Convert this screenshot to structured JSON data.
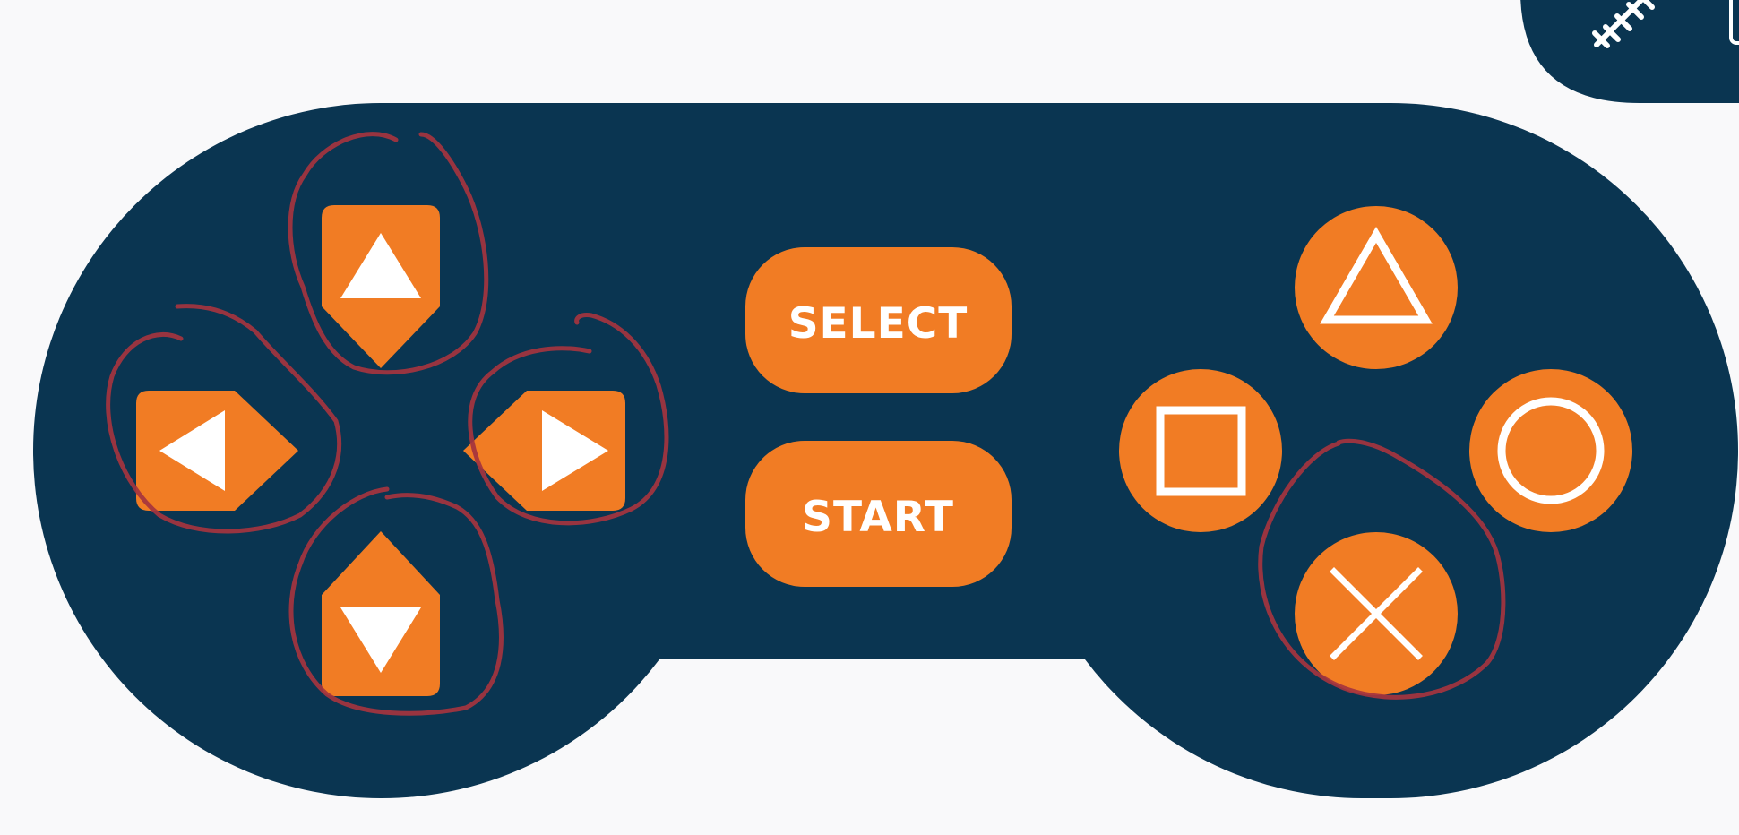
{
  "colors": {
    "background": "#f9f9fa",
    "body": "#0a3551",
    "button": "#f17c24",
    "glyph": "#ffffff",
    "annotation": "#a5343f"
  },
  "dpad": {
    "up_icon": "arrow-up-icon",
    "down_icon": "arrow-down-icon",
    "left_icon": "arrow-left-icon",
    "right_icon": "arrow-right-icon"
  },
  "center": {
    "select_label": "SELECT",
    "start_label": "START"
  },
  "face_buttons": {
    "triangle_icon": "triangle-icon",
    "square_icon": "square-icon",
    "circle_icon": "circle-icon",
    "cross_icon": "cross-icon"
  },
  "corner_panel": {
    "icon": "disconnected-plug-icon"
  }
}
